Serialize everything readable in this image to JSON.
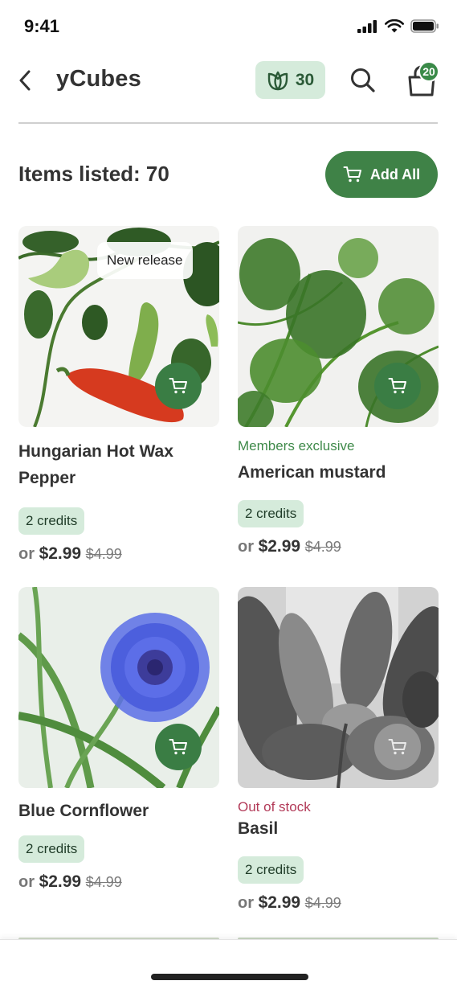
{
  "status": {
    "time": "9:41"
  },
  "header": {
    "title": "yCubes",
    "credits": "30",
    "cart_count": "20"
  },
  "summary": {
    "items_listed": "Items listed: 70",
    "add_all": "Add All"
  },
  "products": [
    {
      "title": "Hungarian Hot Wax Pepper",
      "tag": "New release",
      "label": "",
      "credits": "2 credits",
      "or": "or",
      "price": "$2.99",
      "old_price": "$4.99",
      "available": true
    },
    {
      "title": "American mustard",
      "tag": "",
      "label": "Members exclusive",
      "credits": "2 credits",
      "or": "or",
      "price": "$2.99",
      "old_price": "$4.99",
      "available": true
    },
    {
      "title": "Blue Cornflower",
      "tag": "",
      "label": "",
      "credits": "2 credits",
      "or": "or",
      "price": "$2.99",
      "old_price": "$4.99",
      "available": true
    },
    {
      "title": "Basil",
      "tag": "",
      "label": "Out of stock",
      "credits": "2 credits",
      "or": "or",
      "price": "$2.99",
      "old_price": "$4.99",
      "available": false
    }
  ],
  "colors": {
    "brand_green": "#3f8247",
    "pill_bg": "#d5ebdb",
    "members_label": "#3f8a4a",
    "out_of_stock_label": "#b23a58"
  },
  "icons": [
    "back-chevron-icon",
    "leaf-credit-icon",
    "search-icon",
    "shopping-bag-icon",
    "cart-icon"
  ]
}
